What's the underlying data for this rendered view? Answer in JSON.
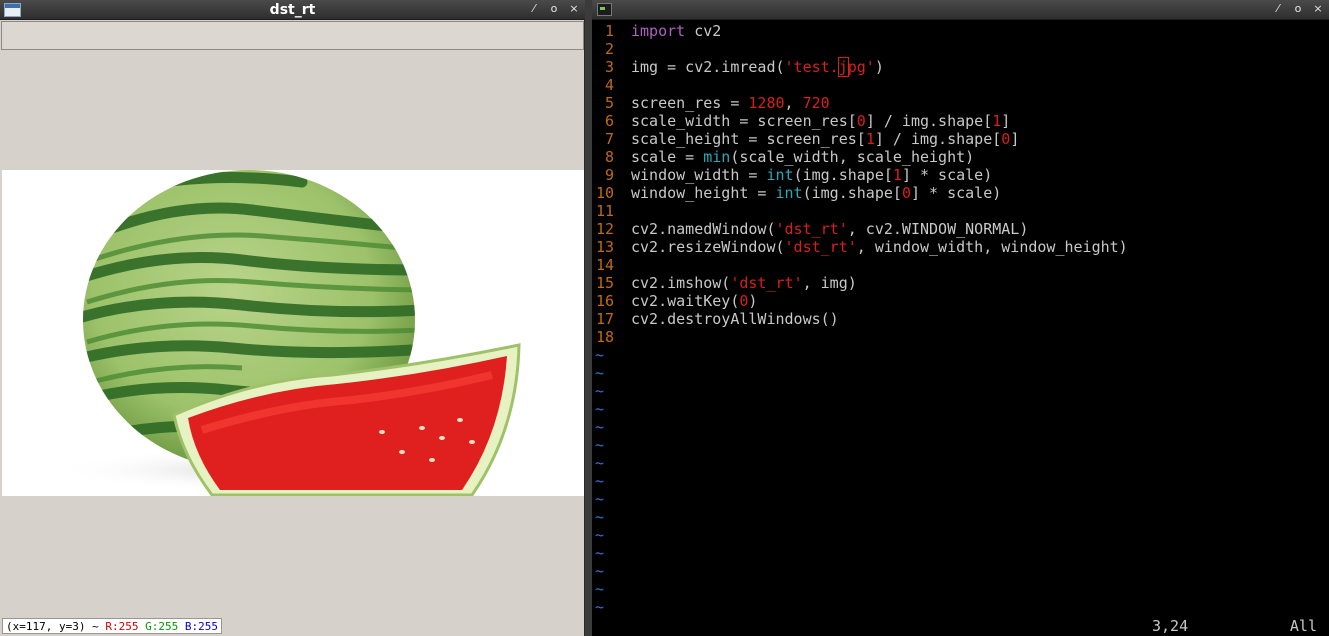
{
  "left_window": {
    "title": "dst_rt",
    "controls": [
      "⁄",
      "o",
      "×"
    ],
    "status": {
      "coords": "(x=117, y=3) ~",
      "r": "R:255",
      "g": "G:255",
      "b": "B:255"
    }
  },
  "right_window": {
    "title": "",
    "controls": [
      "⁄",
      "o",
      "×"
    ],
    "code_lines": [
      {
        "n": "1"
      },
      {
        "n": "2"
      },
      {
        "n": "3"
      },
      {
        "n": "4"
      },
      {
        "n": "5"
      },
      {
        "n": "6"
      },
      {
        "n": "7"
      },
      {
        "n": "8"
      },
      {
        "n": "9"
      },
      {
        "n": "10"
      },
      {
        "n": "11"
      },
      {
        "n": "12"
      },
      {
        "n": "13"
      },
      {
        "n": "14"
      },
      {
        "n": "15"
      },
      {
        "n": "16"
      },
      {
        "n": "17"
      },
      {
        "n": "18"
      }
    ],
    "code": {
      "l1": {
        "kw": "import",
        "rest": " cv2"
      },
      "l3": {
        "a": "img = cv2.imread(",
        "s1": "'test.",
        "cur": "j",
        "s2": "pg'",
        "b": ")"
      },
      "l5": {
        "a": "screen_res = ",
        "n1": "1280",
        "b": ", ",
        "n2": "720"
      },
      "l6": {
        "a": "scale_width = screen_res[",
        "n1": "0",
        "b": "] / img.shape[",
        "n2": "1",
        "c": "]"
      },
      "l7": {
        "a": "scale_height = screen_res[",
        "n1": "1",
        "b": "] / img.shape[",
        "n2": "0",
        "c": "]"
      },
      "l8": {
        "a": "scale = ",
        "bi": "min",
        "b": "(scale_width, scale_height)"
      },
      "l9": {
        "a": "window_width = ",
        "bi": "int",
        "b": "(img.shape[",
        "n1": "1",
        "c": "] * scale)"
      },
      "l10": {
        "a": "window_height = ",
        "bi": "int",
        "b": "(img.shape[",
        "n1": "0",
        "c": "] * scale)"
      },
      "l12": {
        "a": "cv2.namedWindow(",
        "s": "'dst_rt'",
        "b": ", cv2.WINDOW_NORMAL)"
      },
      "l13": {
        "a": "cv2.resizeWindow(",
        "s": "'dst_rt'",
        "b": ", window_width, window_height)"
      },
      "l15": {
        "a": "cv2.imshow(",
        "s": "'dst_rt'",
        "b": ", img)"
      },
      "l16": {
        "a": "cv2.waitKey(",
        "n": "0",
        "b": ")"
      },
      "l17": {
        "a": "cv2.destroyAllWindows()"
      }
    },
    "tilde_char": "~",
    "tilde_count": 15,
    "status_pos": "3,24",
    "status_all": "All"
  }
}
